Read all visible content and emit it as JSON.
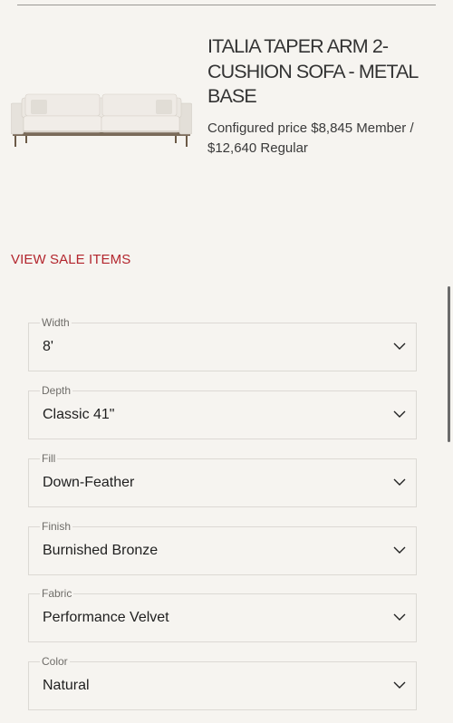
{
  "product": {
    "title": "ITALIA TAPER ARM 2-CUSHION SOFA - METAL BASE",
    "price_text": "Configured price $8,845 Member / $12,640 Regular",
    "image_icon": "sofa-image"
  },
  "sale_link": "VIEW SALE ITEMS",
  "colors": {
    "accent": "#b3262e",
    "background": "#f6f4f0"
  },
  "options": [
    {
      "label": "Width",
      "value": "8'"
    },
    {
      "label": "Depth",
      "value": "Classic 41\""
    },
    {
      "label": "Fill",
      "value": "Down-Feather"
    },
    {
      "label": "Finish",
      "value": "Burnished Bronze"
    },
    {
      "label": "Fabric",
      "value": "Performance Velvet"
    },
    {
      "label": "Color",
      "value": "Natural"
    }
  ]
}
